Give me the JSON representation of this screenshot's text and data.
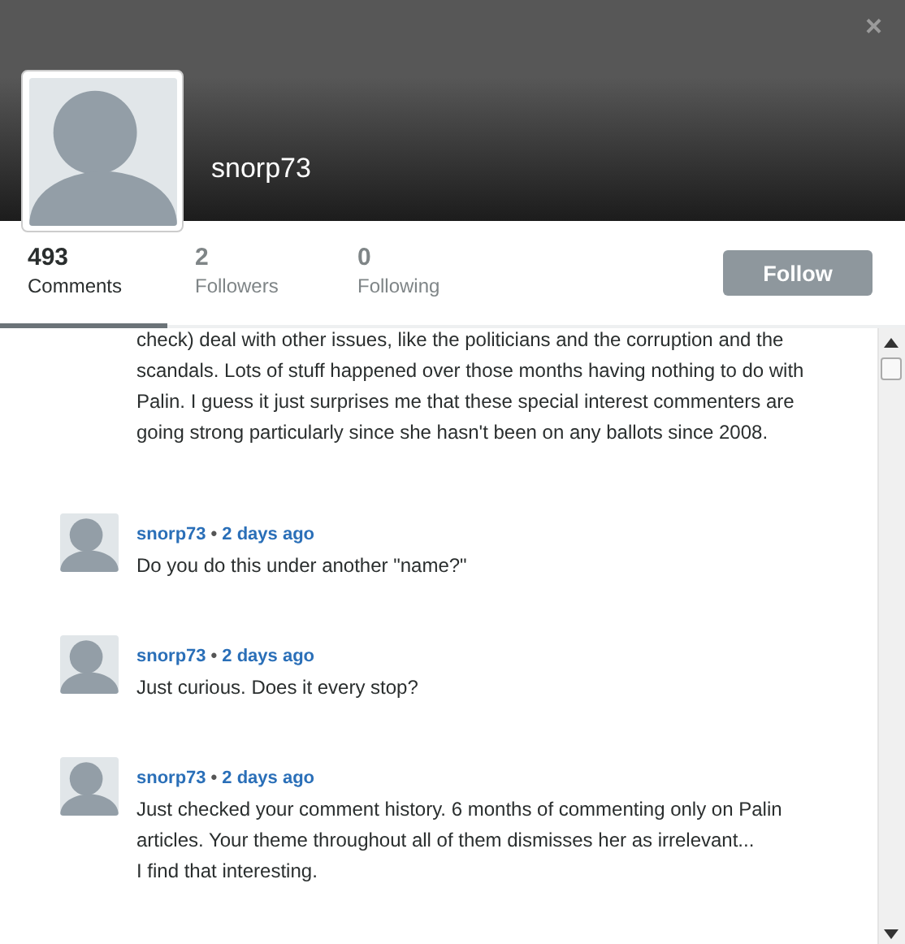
{
  "close_button": "×",
  "profile": {
    "username": "snorp73"
  },
  "stats": [
    {
      "count": "493",
      "label": "Comments",
      "selected": true
    },
    {
      "count": "2",
      "label": "Followers",
      "selected": false
    },
    {
      "count": "0",
      "label": "Following",
      "selected": false
    }
  ],
  "follow_button": "Follow",
  "comments": [
    {
      "paragraphs": [
        "check) deal with other issues, like the politicians and the corruption and the scandals. Lots of stuff happened over those months having nothing to do with Palin. I guess it just surprises me that these special interest commenters are going strong particularly since she hasn't been on any ballots since 2008."
      ]
    },
    {
      "author": "snorp73",
      "separator": "•",
      "time": "2 days ago",
      "paragraphs": [
        "Do you do this under another \"name?\""
      ]
    },
    {
      "author": "snorp73",
      "separator": "•",
      "time": "2 days ago",
      "paragraphs": [
        "Just curious. Does it every stop?"
      ]
    },
    {
      "author": "snorp73",
      "separator": "•",
      "time": "2 days ago",
      "paragraphs": [
        "Just checked your comment history. 6 months of commenting only on Palin articles. Your theme throughout all of them dismisses her as irrelevant...",
        "I find that interesting."
      ]
    }
  ]
}
